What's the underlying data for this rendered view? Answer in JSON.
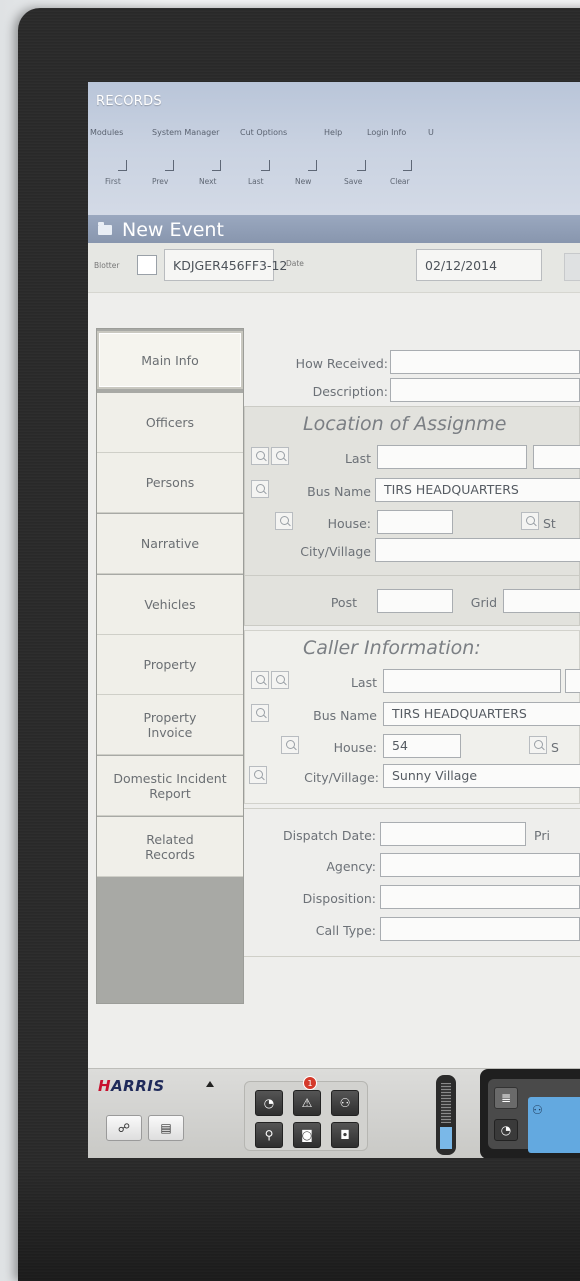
{
  "app": {
    "title": "RECORDS",
    "menu": [
      "Modules",
      "System Manager",
      "Cut Options",
      "Help",
      "Login Info",
      "U"
    ],
    "toolbar": [
      "First",
      "Prev",
      "Next",
      "Last",
      "New",
      "Save",
      "Clear"
    ]
  },
  "event": {
    "title": "New Event",
    "blotter_label": "Blotter",
    "record_id": "KDJGER456FF3-12",
    "date_label": "Date",
    "date": "02/12/2014"
  },
  "tabs": [
    "Main Info",
    "Officers",
    "Persons",
    "Narrative",
    "Vehicles",
    "Property",
    "Property Invoice",
    "Domestic Incident Report",
    "Related Records"
  ],
  "form": {
    "how_received_label": "How Received:",
    "how_received": "",
    "description_label": "Description:",
    "description": "",
    "location": {
      "title": "Location of Assignme",
      "last_label": "Last",
      "last": "",
      "bus_name_label": "Bus Name",
      "bus_name": "TIRS HEADQUARTERS",
      "house_label": "House:",
      "house": "",
      "street_label": "St",
      "city_label": "City/Village",
      "city": "",
      "post_label": "Post",
      "post": "",
      "grid_label": "Grid",
      "grid": ""
    },
    "caller": {
      "title": "Caller Information:",
      "last_label": "Last",
      "last": "",
      "bus_name_label": "Bus Name",
      "bus_name": "TIRS HEADQUARTERS",
      "house_label": "House:",
      "house": "54",
      "street_label": "S",
      "city_label": "City/Village:",
      "city": "Sunny Village"
    },
    "dispatch_date_label": "Dispatch Date:",
    "dispatch_date": "",
    "priority_label": "Pri",
    "agency_label": "Agency:",
    "agency": "",
    "disposition_label": "Disposition:",
    "disposition": "",
    "call_type_label": "Call Type:",
    "call_type": ""
  },
  "dock": {
    "brand": "HARRIS",
    "alert_count": "1"
  }
}
